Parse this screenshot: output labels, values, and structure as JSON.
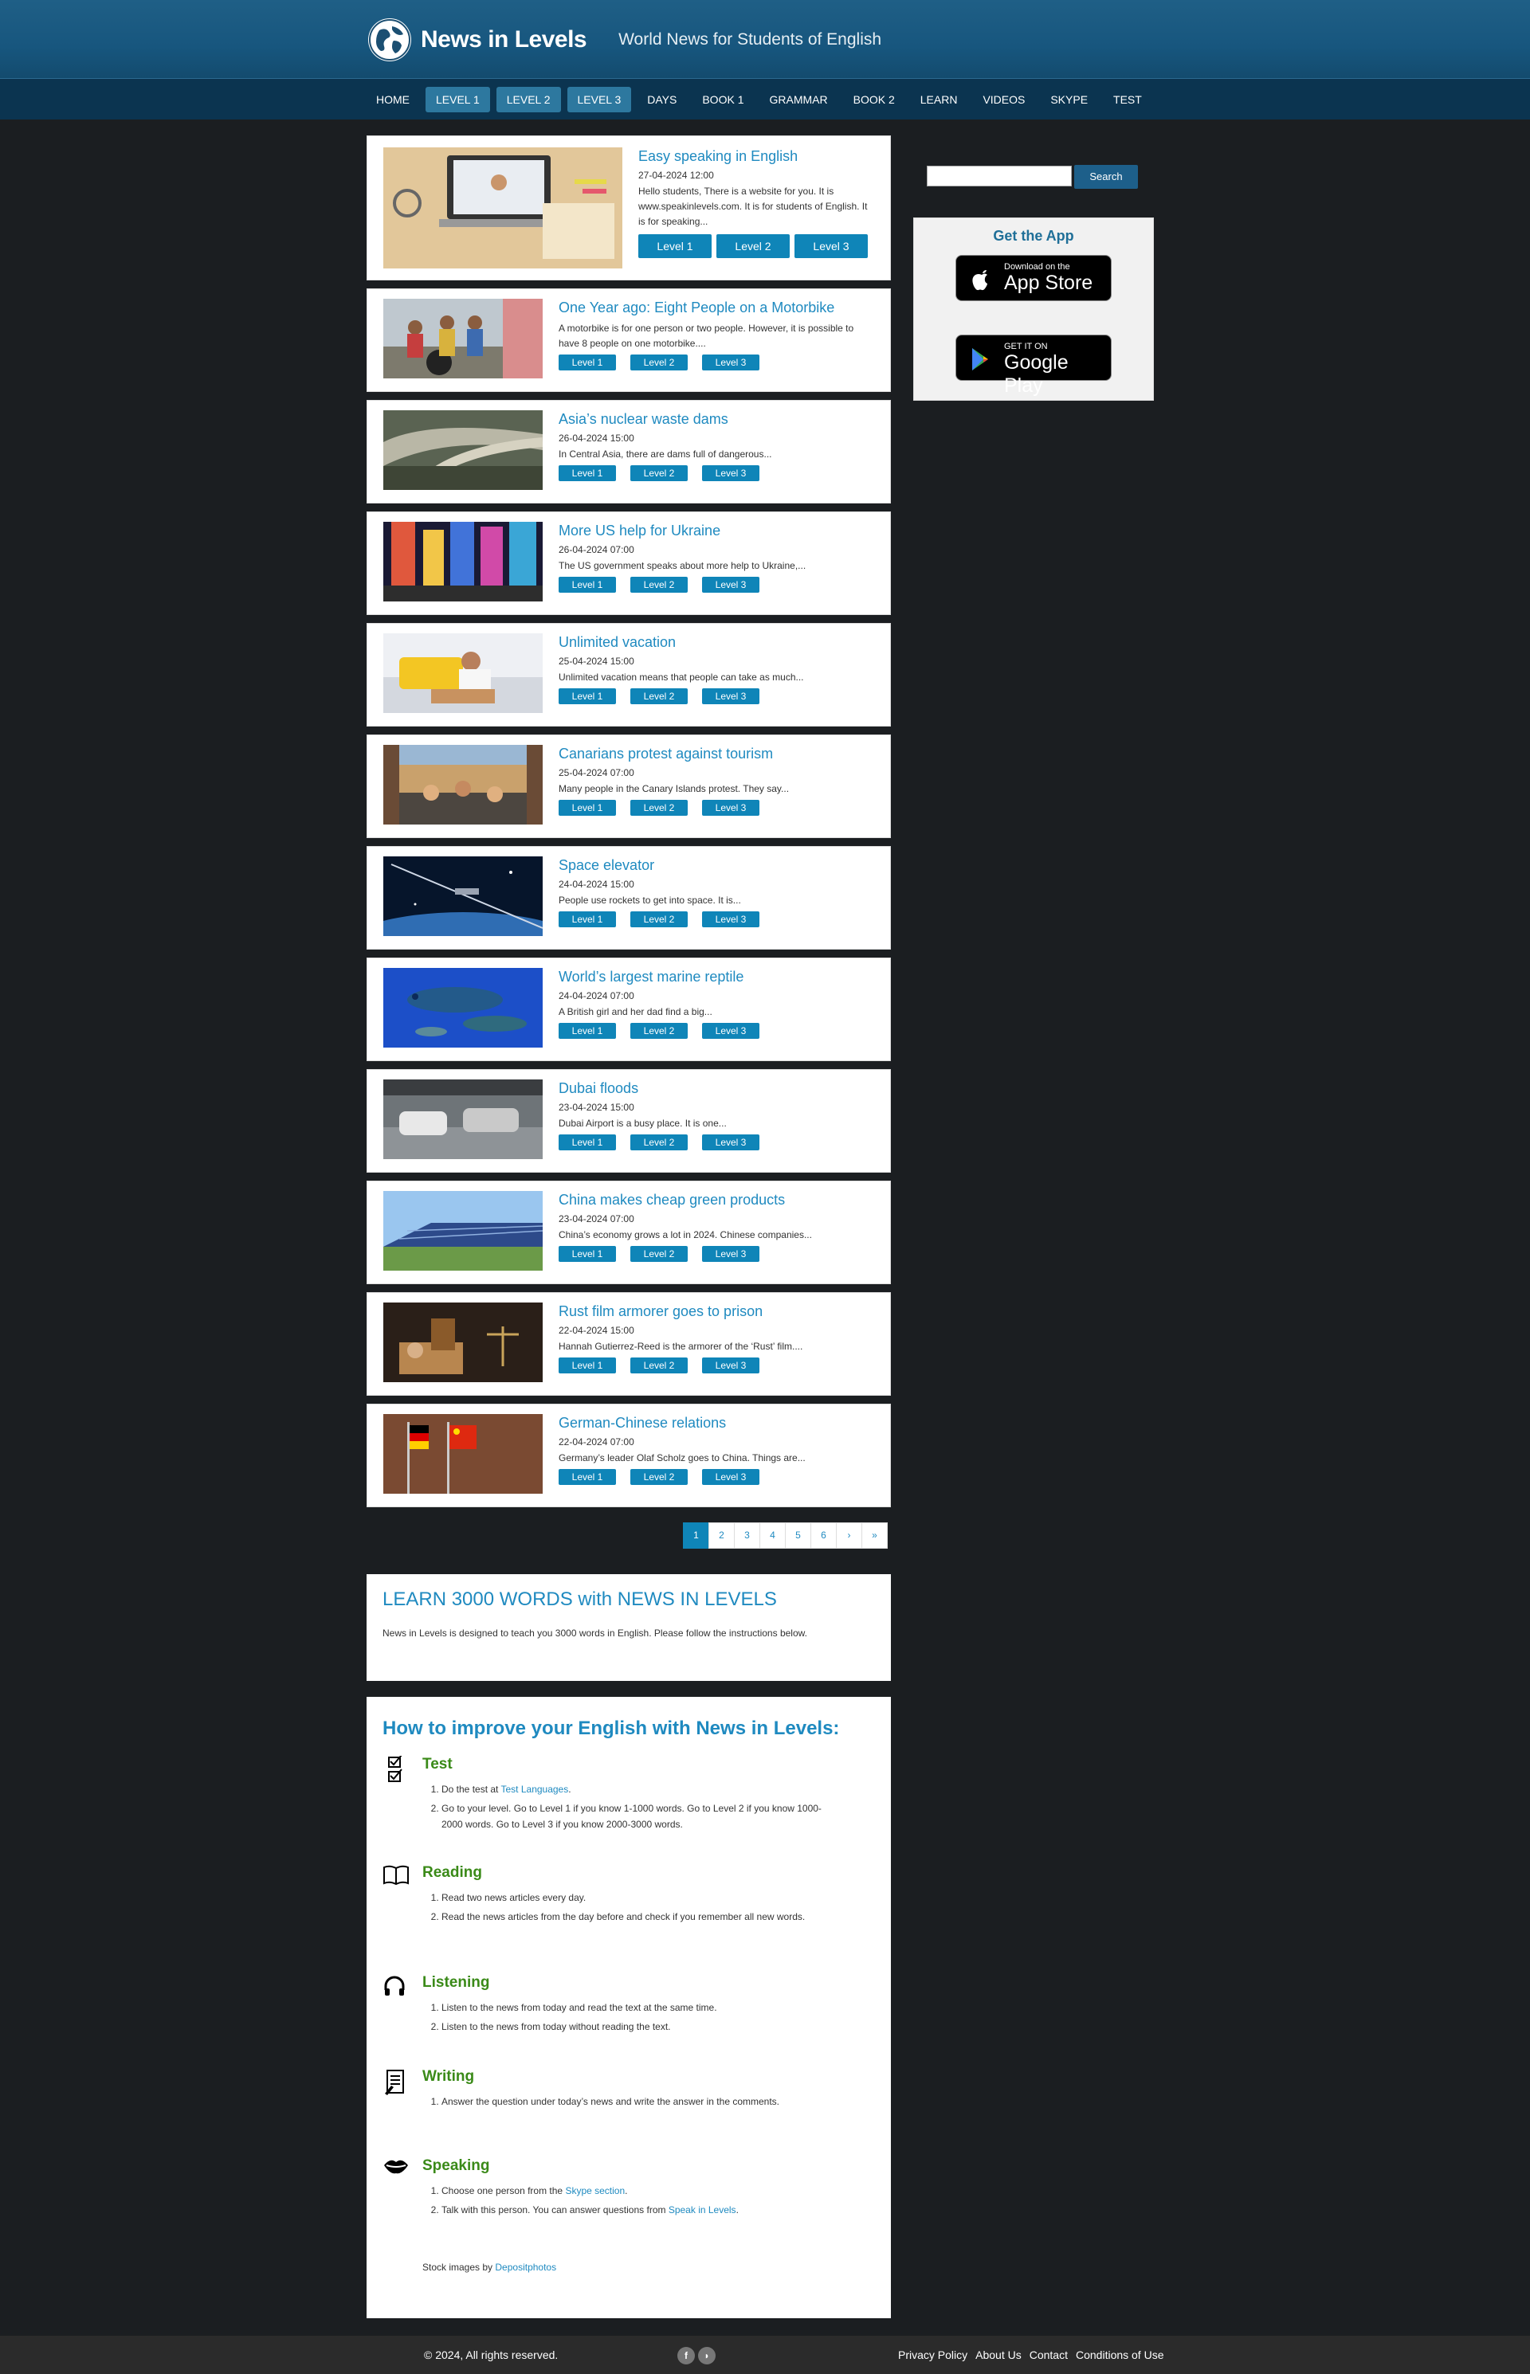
{
  "header": {
    "logo": "News in Levels",
    "tagline": "World News for Students of English"
  },
  "nav": [
    "HOME",
    "LEVEL 1",
    "LEVEL 2",
    "LEVEL 3",
    "DAYS",
    "BOOK 1",
    "GRAMMAR",
    "BOOK 2",
    "LEARN",
    "VIDEOS",
    "SKYPE",
    "TEST"
  ],
  "levels": [
    "Level 1",
    "Level 2",
    "Level 3"
  ],
  "articles": [
    {
      "title": "Easy speaking in English",
      "date": "27-04-2024 12:00",
      "text": "Hello students, There is a website for you. It is www.speakinlevels.com. It is for students of English. It is for speaking..."
    },
    {
      "title": "One Year ago: Eight People on a Motorbike",
      "date": "",
      "text": "A motorbike is for one person or two people. However, it is possible to have 8 people on one motorbike...."
    },
    {
      "title": "Asia’s nuclear waste dams",
      "date": "26-04-2024 15:00",
      "text": "In Central Asia, there are dams full of dangerous..."
    },
    {
      "title": "More US help for Ukraine",
      "date": "26-04-2024 07:00",
      "text": "The US government speaks about more help to Ukraine,..."
    },
    {
      "title": "Unlimited vacation",
      "date": "25-04-2024 15:00",
      "text": "Unlimited vacation means that people can take as much..."
    },
    {
      "title": "Canarians protest against tourism",
      "date": "25-04-2024 07:00",
      "text": "Many people in the Canary Islands protest. They say..."
    },
    {
      "title": "Space elevator",
      "date": "24-04-2024 15:00",
      "text": "People use rockets to get into space. It is..."
    },
    {
      "title": "World’s largest marine reptile",
      "date": "24-04-2024 07:00",
      "text": "A British girl and her dad find a big..."
    },
    {
      "title": "Dubai floods",
      "date": "23-04-2024 15:00",
      "text": "Dubai Airport is a busy place. It is one..."
    },
    {
      "title": "China makes cheap green products",
      "date": "23-04-2024 07:00",
      "text": "China’s economy grows a lot in 2024. Chinese companies..."
    },
    {
      "title": "Rust film armorer goes to prison",
      "date": "22-04-2024 15:00",
      "text": "Hannah Gutierrez-Reed is the armorer of the ‘Rust’ film...."
    },
    {
      "title": "German-Chinese relations",
      "date": "22-04-2024 07:00",
      "text": "Germany’s leader Olaf Scholz goes to China. Things are..."
    }
  ],
  "pager": [
    "1",
    "2",
    "3",
    "4",
    "5",
    "6",
    "›",
    "»"
  ],
  "learn": {
    "title": "LEARN 3000 WORDS with NEWS IN LEVELS",
    "text": "News in Levels is designed to teach you 3000 words in English. Please follow the instructions below."
  },
  "howto": {
    "title": "How to improve your English with News in Levels:",
    "test_head": "Test",
    "test_1a": "Do the test at ",
    "test_1_link": "Test Languages",
    "test_1b": ".",
    "test_2": "Go to your level. Go to Level 1 if you know 1-1000 words. Go to Level 2 if you know 1000-2000 words. Go to Level 3 if you know 2000-3000 words.",
    "reading_head": "Reading",
    "reading_1": "Read two news articles every day.",
    "reading_2": "Read the news articles from the day before and check if you remember all new words.",
    "listening_head": "Listening",
    "listening_1": "Listen to the news from today and read the text at the same time.",
    "listening_2": "Listen to the news from today without reading the text.",
    "writing_head": "Writing",
    "writing_1": "Answer the question under today’s news and write the answer in the comments.",
    "speaking_head": "Speaking",
    "speaking_1a": "Choose one person from the ",
    "speaking_1_link": "Skype section",
    "speaking_1b": ".",
    "speaking_2a": "Talk with this person. You can answer questions from ",
    "speaking_2_link": "Speak in Levels",
    "speaking_2b": ".",
    "stock_a": "Stock images by ",
    "stock_link": "Depositphotos"
  },
  "sidebar": {
    "search_label": "Search",
    "app_title": "Get the App",
    "appstore_small": "Download on the",
    "appstore_big": "App Store",
    "gplay_small": "GET IT ON",
    "gplay_big": "Google Play"
  },
  "footer": {
    "copy": "© 2024, All rights reserved.",
    "links": [
      "Privacy Policy",
      "About Us",
      "Contact",
      "Conditions of Use"
    ]
  },
  "colors": {
    "accent": "#0f85b8",
    "header": "#17567e",
    "nav": "#0b3450",
    "green": "#3a8a18"
  }
}
